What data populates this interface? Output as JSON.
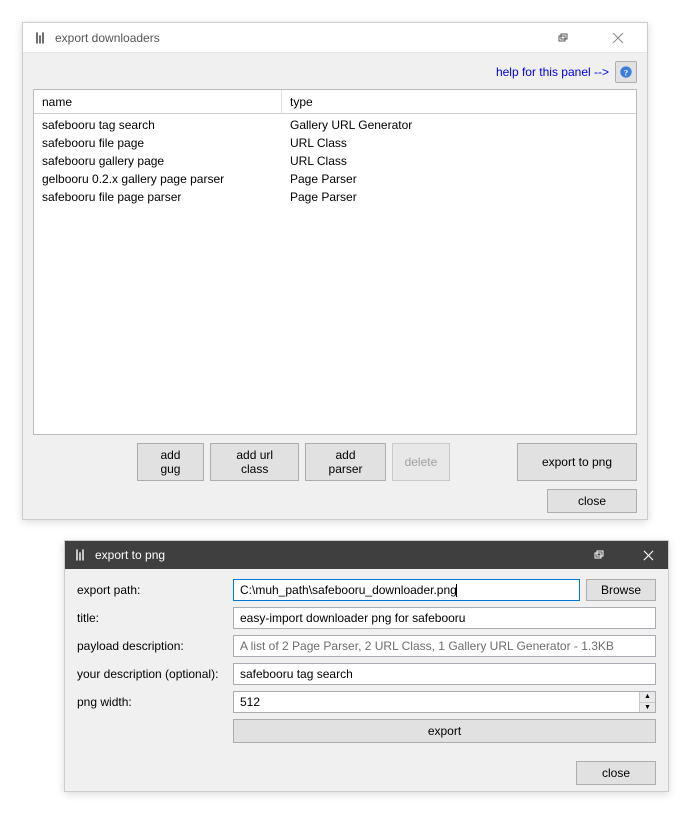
{
  "window1": {
    "title": "export downloaders",
    "help_link": "help for this panel -->",
    "table": {
      "headers": {
        "name": "name",
        "type": "type"
      },
      "rows": [
        {
          "name": "safebooru tag search",
          "type": "Gallery URL Generator"
        },
        {
          "name": "safebooru file page",
          "type": "URL Class"
        },
        {
          "name": "safebooru gallery page",
          "type": "URL Class"
        },
        {
          "name": "gelbooru 0.2.x gallery page parser",
          "type": "Page Parser"
        },
        {
          "name": "safebooru file page parser",
          "type": "Page Parser"
        }
      ]
    },
    "buttons": {
      "add_gug": "add gug",
      "add_url_class": "add url class",
      "add_parser": "add parser",
      "delete": "delete",
      "export_png": "export to png",
      "close": "close"
    }
  },
  "window2": {
    "title": "export to png",
    "labels": {
      "export_path": "export path:",
      "title": "title:",
      "payload_description": "payload description:",
      "your_description": "your description (optional):",
      "png_width": "png width:"
    },
    "values": {
      "export_path": "C:\\muh_path\\safebooru_downloader.png",
      "title": "easy-import downloader png for safebooru",
      "payload_description": "A list of 2 Page Parser, 2 URL Class, 1 Gallery URL Generator - 1.3KB",
      "your_description": "safebooru tag search",
      "png_width": "512"
    },
    "buttons": {
      "browse": "Browse",
      "export": "export",
      "close": "close"
    }
  }
}
